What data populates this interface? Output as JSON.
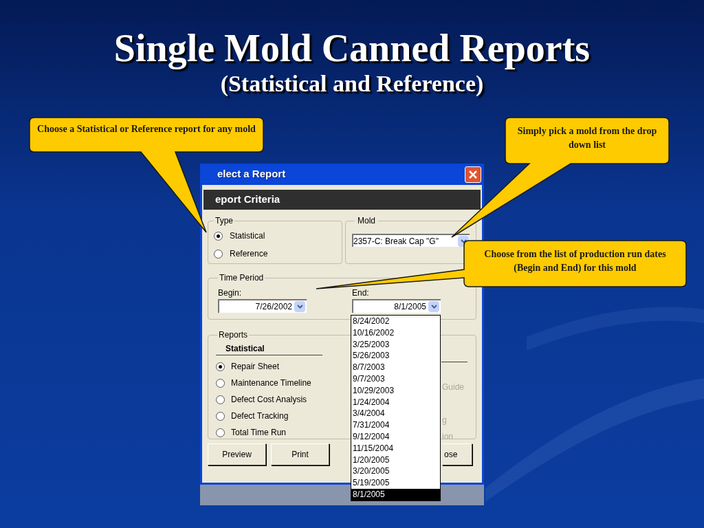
{
  "slide": {
    "title": "Single Mold Canned Reports",
    "subtitle": "(Statistical and Reference)"
  },
  "callouts": [
    {
      "text": "Choose a Statistical or Reference report for any mold"
    },
    {
      "text": "Simply pick a mold from the drop down list"
    },
    {
      "text": "Choose from the list of production run dates (Begin and End) for this mold"
    }
  ],
  "dialog": {
    "title": "elect a Report",
    "header": "eport Criteria",
    "type_group": {
      "label": "Type",
      "options": [
        {
          "label": "Statistical",
          "selected": true
        },
        {
          "label": "Reference",
          "selected": false
        }
      ]
    },
    "mold_group": {
      "label": "Mold",
      "value": "2357-C: Break Cap \"G\""
    },
    "time_period": {
      "label": "Time Period",
      "begin": {
        "label": "Begin:",
        "value": "7/26/2002"
      },
      "end": {
        "label": "End:",
        "value": "8/1/2005"
      }
    },
    "reports": {
      "label": "Reports",
      "heading": "Statistical",
      "options": [
        {
          "label": "Repair Sheet",
          "selected": true
        },
        {
          "label": "Maintenance Timeline",
          "selected": false
        },
        {
          "label": "Defect Cost Analysis",
          "selected": false
        },
        {
          "label": "Defect Tracking",
          "selected": false
        },
        {
          "label": "Total Time Run",
          "selected": false
        }
      ],
      "partial_labels": [
        {
          "label": "Guide",
          "disabled": true
        },
        {
          "label": "g",
          "disabled": true
        },
        {
          "label": "ion",
          "disabled": true
        }
      ]
    },
    "buttons": [
      "Preview",
      "Print",
      "ose"
    ],
    "date_list": [
      {
        "label": "8/24/2002",
        "selected": false
      },
      {
        "label": "10/16/2002",
        "selected": false
      },
      {
        "label": "3/25/2003",
        "selected": false
      },
      {
        "label": "5/26/2003",
        "selected": false
      },
      {
        "label": "8/7/2003",
        "selected": false
      },
      {
        "label": "9/7/2003",
        "selected": false
      },
      {
        "label": "10/29/2003",
        "selected": false
      },
      {
        "label": "1/24/2004",
        "selected": false
      },
      {
        "label": "3/4/2004",
        "selected": false
      },
      {
        "label": "7/31/2004",
        "selected": false
      },
      {
        "label": "9/12/2004",
        "selected": false
      },
      {
        "label": "11/15/2004",
        "selected": false
      },
      {
        "label": "1/20/2005",
        "selected": false
      },
      {
        "label": "3/20/2005",
        "selected": false
      },
      {
        "label": "5/19/2005",
        "selected": false
      },
      {
        "label": "8/1/2005",
        "selected": true
      }
    ]
  }
}
